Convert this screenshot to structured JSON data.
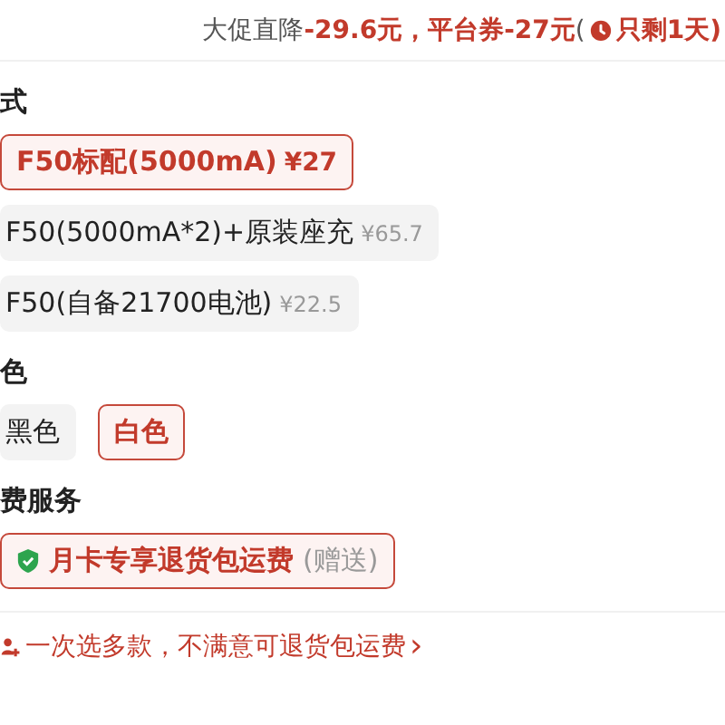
{
  "promo": [
    {
      "kind": "plain",
      "text": "大促直降"
    },
    {
      "kind": "accent",
      "text": "-29.6元，"
    },
    {
      "kind": "accent",
      "text": "平台券-27元"
    },
    {
      "kind": "plain",
      "text": "("
    },
    {
      "kind": "clock",
      "text": "只剩1天)"
    }
  ],
  "sections": [
    {
      "title": "式",
      "options": [
        {
          "label": "F50标配(5000mA)",
          "price": "¥27",
          "selected": true
        },
        {
          "label": "F50(5000mA*2)+原装座充",
          "price": "¥65.7",
          "selected": false
        },
        {
          "label": "F50(自备21700电池)",
          "price": "¥22.5",
          "selected": false
        }
      ]
    },
    {
      "title": "色",
      "options": [
        {
          "label": "黑色",
          "selected": false
        },
        {
          "label": "白色",
          "selected": true
        }
      ]
    }
  ],
  "service": {
    "title": "费服务",
    "label": "月卡专享退货包运费",
    "note": "(赠送)",
    "selected": true
  },
  "footer": {
    "text": "一次选多款，不满意可退货包运费",
    "arrow": "›"
  }
}
